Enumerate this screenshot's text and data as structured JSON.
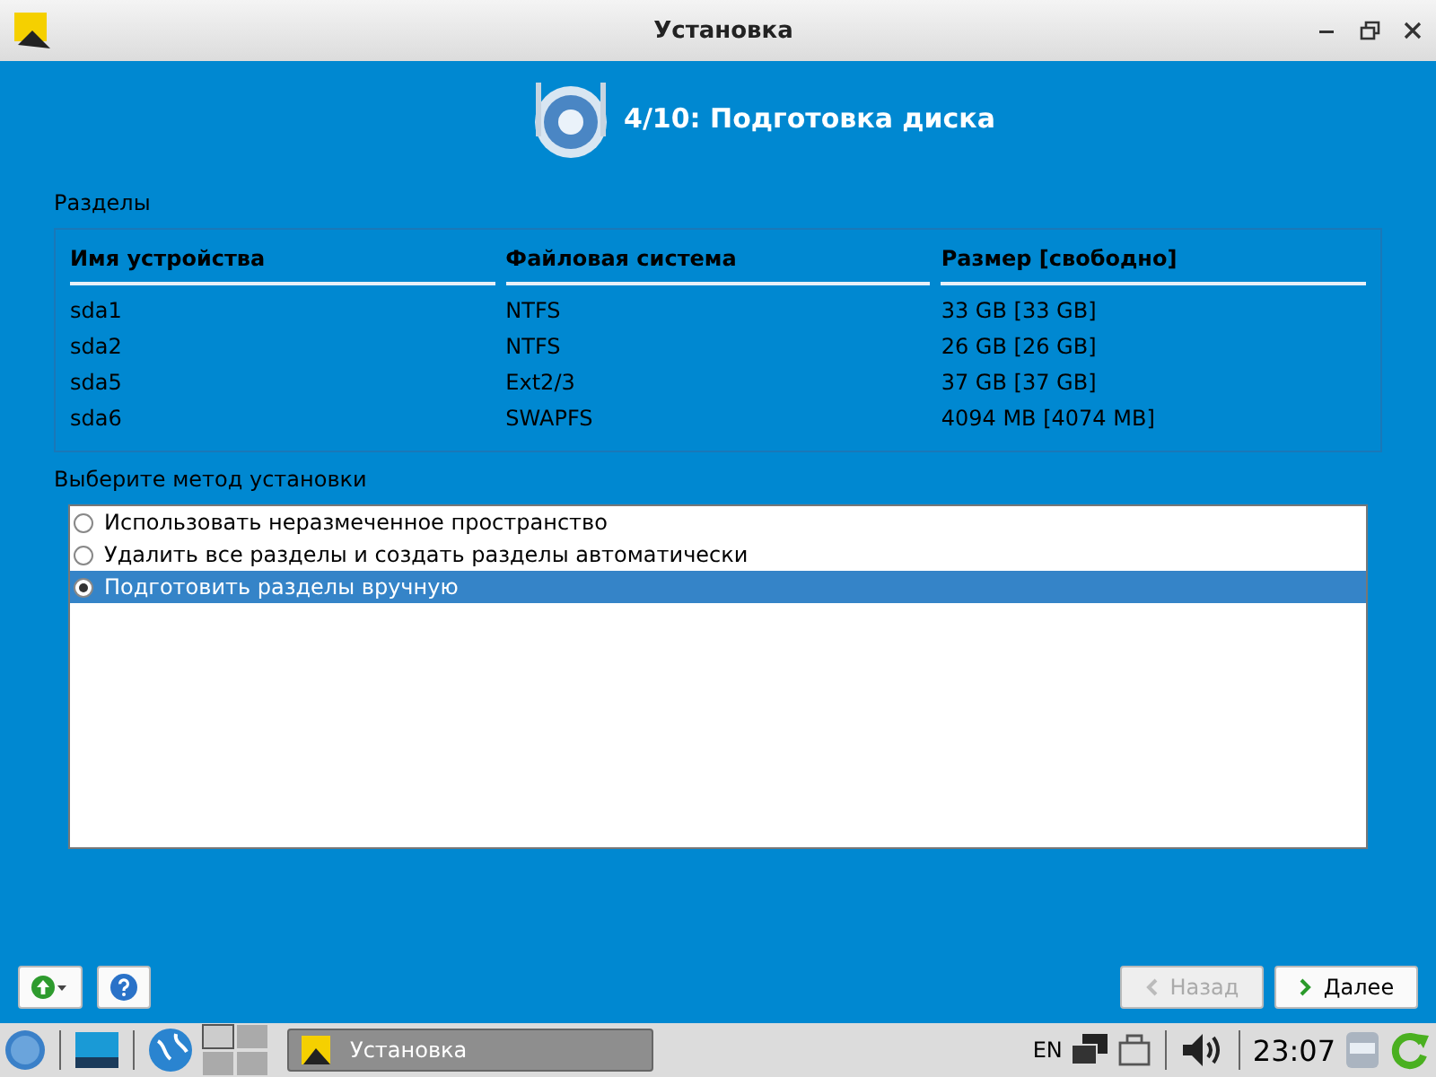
{
  "window": {
    "title": "Установка"
  },
  "step": {
    "title": "4/10: Подготовка диска"
  },
  "partitions": {
    "label": "Разделы",
    "columns": [
      "Имя устройства",
      "Файловая система",
      "Размер [свободно]"
    ],
    "rows": [
      [
        "sda1",
        "NTFS",
        "33 GB [33 GB]"
      ],
      [
        "sda2",
        "NTFS",
        "26 GB [26 GB]"
      ],
      [
        "sda5",
        "Ext2/3",
        "37 GB [37 GB]"
      ],
      [
        "sda6",
        "SWAPFS",
        "4094 MB [4074 MB]"
      ]
    ]
  },
  "method": {
    "label": "Выберите метод установки",
    "options": [
      {
        "label": "Использовать неразмеченное пространство",
        "selected": false
      },
      {
        "label": "Удалить все разделы и создать разделы автоматически",
        "selected": false
      },
      {
        "label": "Подготовить разделы вручную",
        "selected": true
      }
    ]
  },
  "buttons": [
    {
      "label": "Назад",
      "kind": "back",
      "disabled": true
    },
    {
      "label": "Далее",
      "kind": "next",
      "disabled": false
    }
  ],
  "taskbar": {
    "task": "Установка",
    "layout": "EN",
    "clock": "23:07"
  }
}
